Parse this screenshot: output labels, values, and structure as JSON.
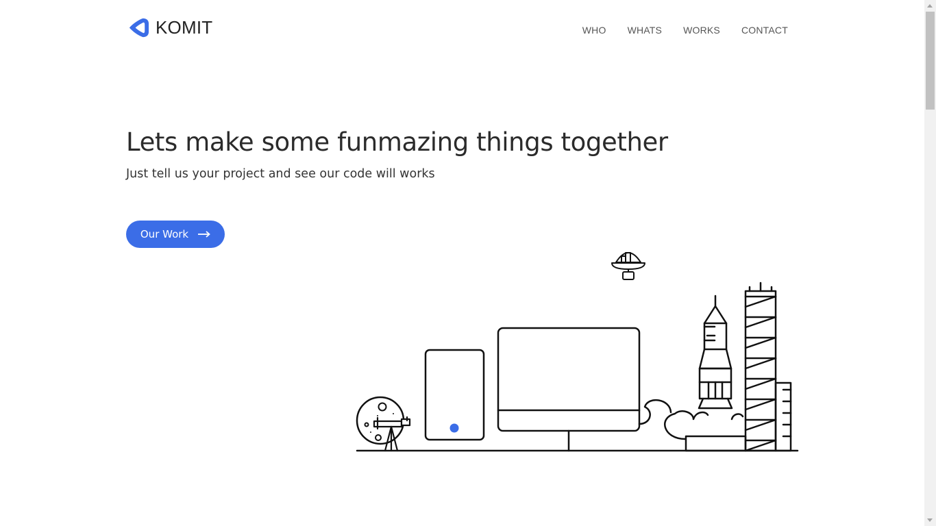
{
  "brand": {
    "name": "KOMIT",
    "logo_icon": "komit-chevron-logo",
    "accent_color": "#3b6de7"
  },
  "nav": {
    "items": [
      {
        "label": "WHO"
      },
      {
        "label": "WHATS"
      },
      {
        "label": "WORKS"
      },
      {
        "label": "CONTACT"
      }
    ]
  },
  "hero": {
    "title": "Lets make some funmazing things together",
    "subtitle": "Just tell us your project and see our code will works",
    "cta_label": "Our Work",
    "cta_icon": "arrow-right-icon"
  },
  "illustration": {
    "icons": [
      "satellite-icon",
      "moon-icon",
      "telescope-icon",
      "tablet-icon",
      "monitor-icon",
      "cloud-icon",
      "rocket-icon",
      "tower-icon"
    ]
  }
}
